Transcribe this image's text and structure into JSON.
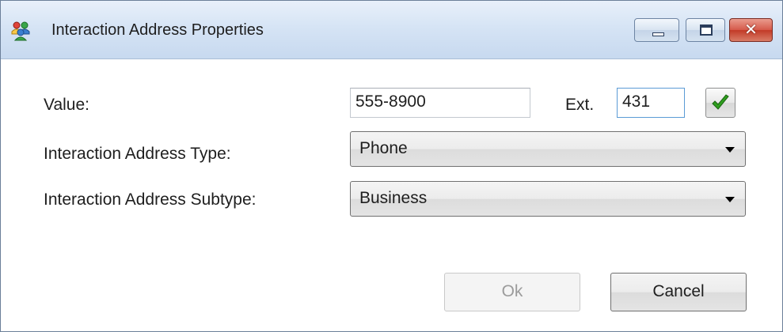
{
  "window": {
    "title": "Interaction Address Properties",
    "icon": "people-app-icon",
    "controls": [
      "minimize-icon",
      "maximize-icon",
      "close-icon"
    ],
    "close_glyph": "✕"
  },
  "form": {
    "value_label": "Value:",
    "value": "555-8900",
    "ext_label": "Ext.",
    "ext_value": "431",
    "validate_icon": "checkmark-icon",
    "type_label": "Interaction Address Type:",
    "type_value": "Phone",
    "subtype_label": "Interaction Address Subtype:",
    "subtype_value": "Business"
  },
  "buttons": {
    "ok_label": "Ok",
    "ok_enabled": false,
    "cancel_label": "Cancel"
  },
  "colors": {
    "check_green": "#2f9e1f",
    "focus_border": "#5b9bd5",
    "close_red": "#c23a27"
  }
}
